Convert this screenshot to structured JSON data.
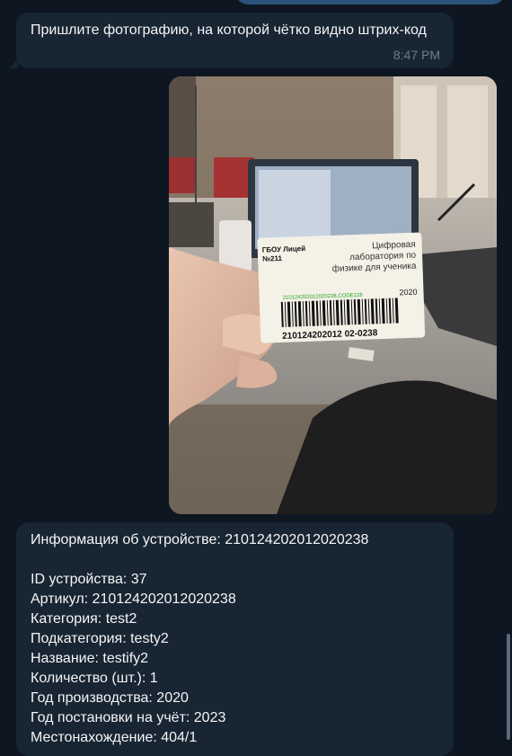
{
  "messages": [
    {
      "text": "Пришлите фотографию, на которой чётко видно штрих-код",
      "time": "8:47 PM"
    }
  ],
  "photo": {
    "label": {
      "org_line1": "ГБОУ Лицей",
      "org_line2": "№211",
      "title_line1": "Цифровая",
      "title_line2": "лаборатория по",
      "title_line3": "физике для ученика",
      "year": "2020",
      "code_line": "210124202012020238,CODE128",
      "barcode_text": "210124202012 02-0238"
    }
  },
  "device_info": {
    "header": "Информация об устройстве: 210124202012020238",
    "fields": [
      "ID устройства: 37",
      "Артикул: 210124202012020238",
      "Категория: test2",
      "Подкатегория: testy2",
      "Название: testify2",
      "Количество (шт.): 1",
      "Год производства: 2020",
      "Год постановки на учёт: 2023",
      "Местонахождение: 404/1"
    ]
  },
  "colors": {
    "background": "#0e1621",
    "incoming_bubble": "#182533",
    "outgoing_bubble": "#2b5278",
    "timestamp": "#6d7f8f"
  }
}
